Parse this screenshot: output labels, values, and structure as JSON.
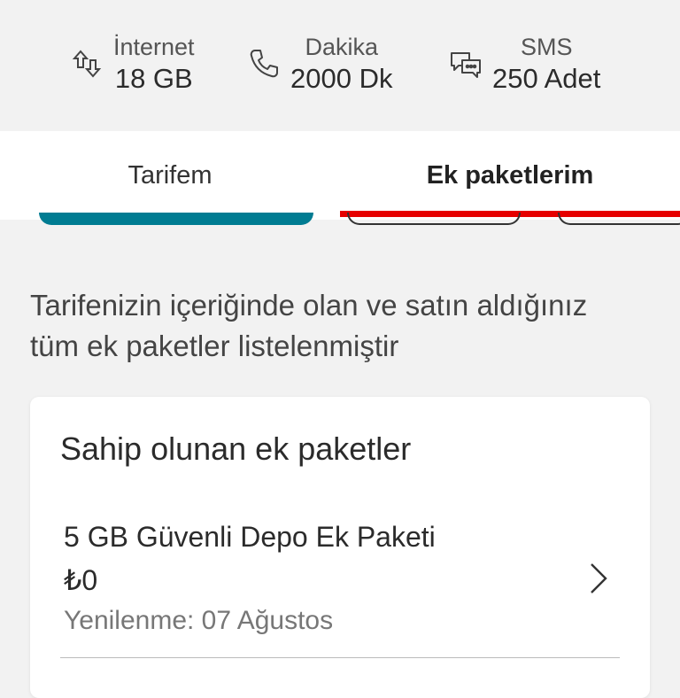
{
  "usage": [
    {
      "label": "İnternet",
      "value": "18 GB",
      "icon": "data-transfer-icon"
    },
    {
      "label": "Dakika",
      "value": "2000 Dk",
      "icon": "phone-icon"
    },
    {
      "label": "SMS",
      "value": "250 Adet",
      "icon": "chat-icon"
    }
  ],
  "tabs": [
    {
      "label": "Tarifem",
      "active": false
    },
    {
      "label": "Ek paketlerim",
      "active": true
    }
  ],
  "description": "Tarifenizin içeriğinde olan ve satın aldığınız tüm ek paketler listelenmiştir",
  "card": {
    "title": "Sahip olunan ek paketler",
    "packages": [
      {
        "name": "5 GB Güvenli Depo Ek Paketi",
        "price": "₺0",
        "renewal": "Yenilenme: 07 Ağustos",
        "icon": "chevron-right-icon"
      }
    ]
  },
  "colors": {
    "accent": "#e60000",
    "teal": "#007c92",
    "background": "#f2f2f2"
  }
}
